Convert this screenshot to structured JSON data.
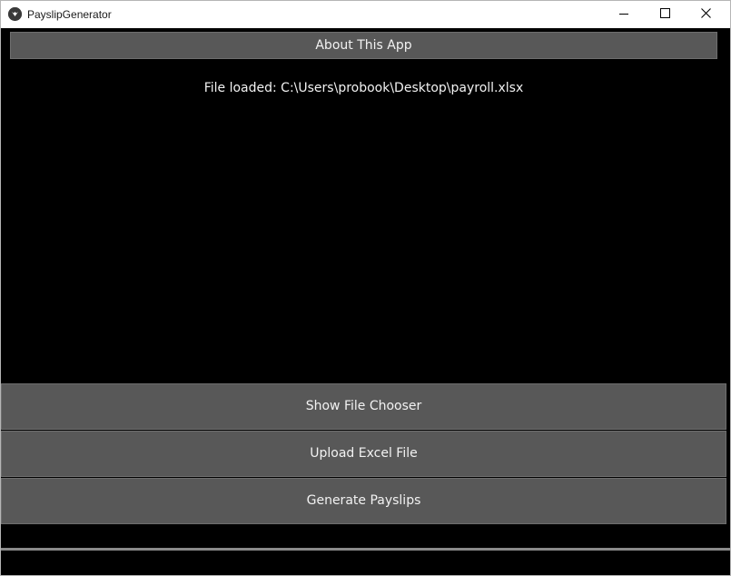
{
  "window": {
    "title": "PayslipGenerator",
    "icon": "kivy-app-icon",
    "controls": [
      "minimize-icon",
      "maximize-icon",
      "close-icon"
    ]
  },
  "header": {
    "about_label": "About This App"
  },
  "status": {
    "text": "File loaded: C:\\Users\\probook\\Desktop\\payroll.xlsx"
  },
  "actions": {
    "show_file_chooser": "Show File Chooser",
    "upload_excel": "Upload Excel File",
    "generate_payslips": "Generate Payslips"
  },
  "colors": {
    "background": "#000000",
    "button": "#585858",
    "button_border": "#6e6e6e",
    "text": "#f2f2f2",
    "titlebar": "#ffffff"
  }
}
